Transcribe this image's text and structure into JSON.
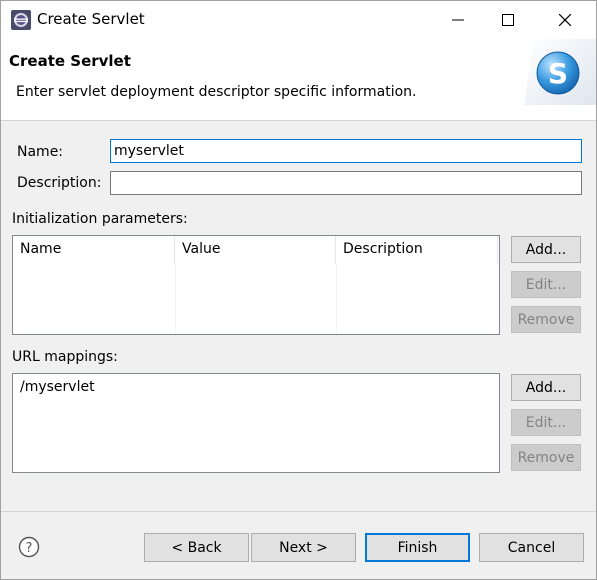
{
  "window": {
    "title": "Create Servlet",
    "icons": {
      "app": "eclipse-icon",
      "minimize": "minimize-icon",
      "maximize": "maximize-icon",
      "close": "close-icon"
    }
  },
  "banner": {
    "title": "Create Servlet",
    "description": "Enter servlet deployment descriptor specific information.",
    "logo_icon": "servlet-s-logo-icon",
    "logo_letter": "S"
  },
  "form": {
    "name_label": "Name:",
    "name_value": "myservlet",
    "description_label": "Description:",
    "description_value": ""
  },
  "init_params": {
    "label": "Initialization parameters:",
    "columns": [
      "Name",
      "Value",
      "Description"
    ],
    "rows": [],
    "buttons": {
      "add": "Add...",
      "edit": "Edit...",
      "remove": "Remove"
    }
  },
  "url_mappings": {
    "label": "URL mappings:",
    "items": [
      "/myservlet"
    ],
    "buttons": {
      "add": "Add...",
      "edit": "Edit...",
      "remove": "Remove"
    }
  },
  "footer": {
    "help_icon": "help-question-icon",
    "back": "< Back",
    "next": "Next >",
    "finish": "Finish",
    "cancel": "Cancel"
  },
  "colors": {
    "accent": "#0078d7",
    "logo_blue": "#2a8fd6"
  }
}
